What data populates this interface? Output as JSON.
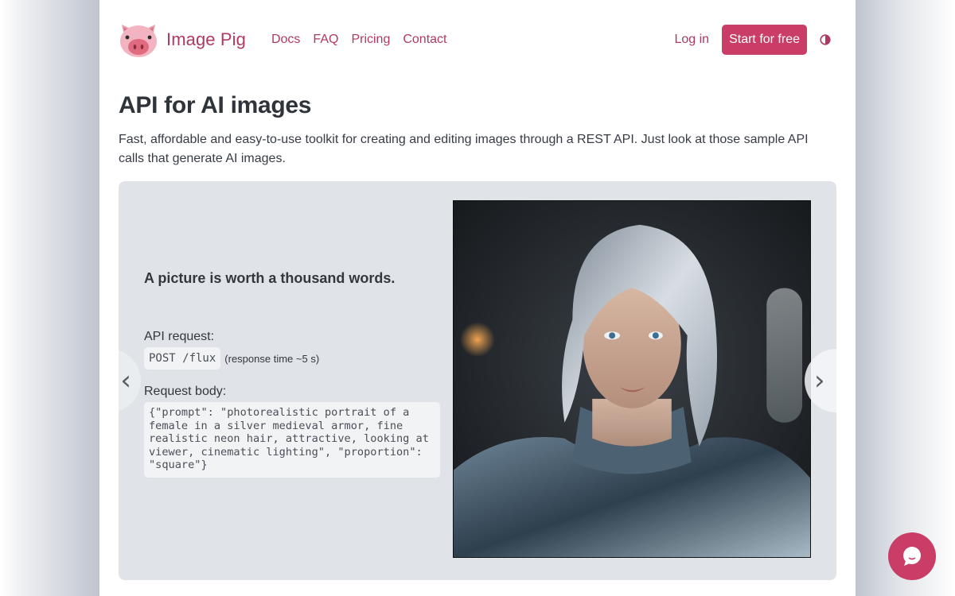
{
  "brand": {
    "name": "Image Pig",
    "logo_icon": "pig-face-icon",
    "accent_color": "#c93d66",
    "link_color": "#b03a5f"
  },
  "nav": {
    "links": [
      {
        "label": "Docs"
      },
      {
        "label": "FAQ"
      },
      {
        "label": "Pricing"
      },
      {
        "label": "Contact"
      }
    ],
    "login_label": "Log in",
    "cta_label": "Start for free",
    "theme_toggle_icon": "half-circle-contrast-icon"
  },
  "hero": {
    "title": "API for AI images",
    "lead": "Fast, affordable and easy-to-use toolkit for creating and editing images through a REST API. Just look at those sample API calls that generate AI images."
  },
  "carousel": {
    "prev_icon": "‹",
    "next_icon": "›",
    "slide": {
      "tagline": "A picture is worth a thousand words.",
      "request_label": "API request:",
      "endpoint": "POST /flux",
      "response_time": "(response time ~5 s)",
      "body_label": "Request body:",
      "body": "{\"prompt\": \"photorealistic portrait of a female in a silver medieval armor, fine realistic neon hair, attractive, looking at viewer, cinematic lighting\", \"proportion\": \"square\"}",
      "image_alt": "AI-generated portrait of a silver-haired woman in silver medieval armor"
    }
  },
  "chat": {
    "icon": "chat-bubble-icon"
  }
}
